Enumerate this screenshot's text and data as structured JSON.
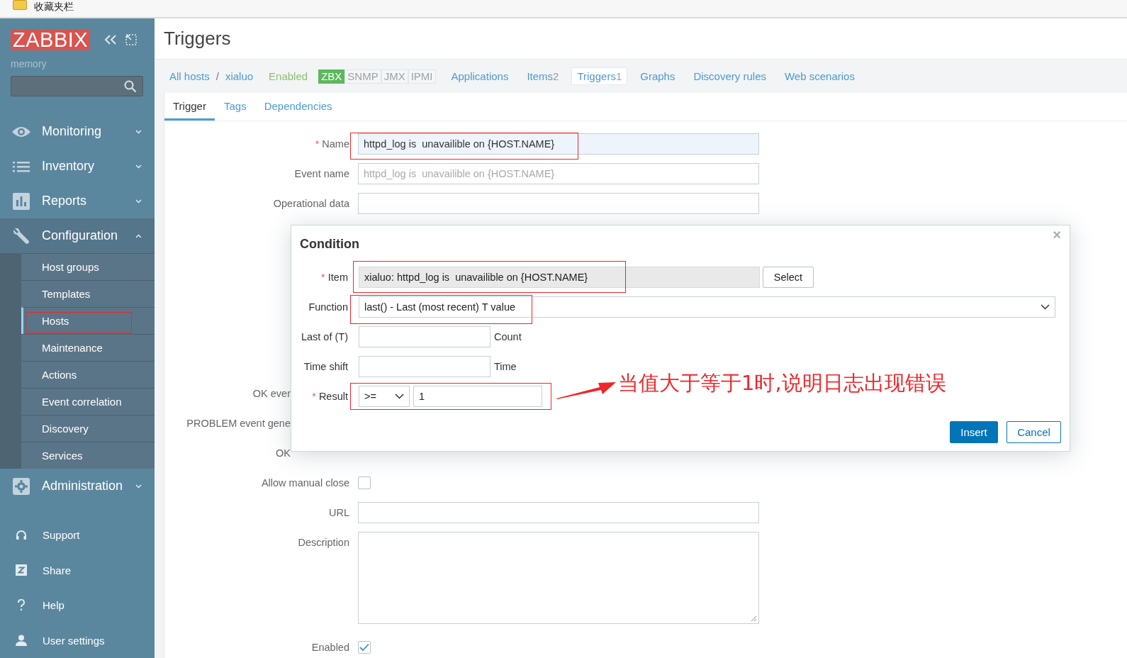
{
  "browser_bar": {
    "bookmarks_label": "收藏夹栏"
  },
  "sidebar": {
    "logo": "ZABBIX",
    "server_name": "memory",
    "menu": [
      {
        "label": "Monitoring",
        "expanded": false
      },
      {
        "label": "Inventory",
        "expanded": false
      },
      {
        "label": "Reports",
        "expanded": false
      },
      {
        "label": "Configuration",
        "expanded": true,
        "children": [
          {
            "label": "Host groups",
            "selected": false
          },
          {
            "label": "Templates",
            "selected": false
          },
          {
            "label": "Hosts",
            "selected": true
          },
          {
            "label": "Maintenance",
            "selected": false
          },
          {
            "label": "Actions",
            "selected": false
          },
          {
            "label": "Event correlation",
            "selected": false
          },
          {
            "label": "Discovery",
            "selected": false
          },
          {
            "label": "Services",
            "selected": false
          }
        ]
      },
      {
        "label": "Administration",
        "expanded": false
      }
    ],
    "footer_links": [
      "Support",
      "Share",
      "Help",
      "User settings"
    ]
  },
  "page": {
    "title": "Triggers",
    "breadcrumb": {
      "items": [
        "All hosts",
        "xialuo"
      ],
      "separator": "/"
    },
    "status": "Enabled",
    "availability": [
      {
        "label": "ZBX",
        "on": true
      },
      {
        "label": "SNMP",
        "on": false
      },
      {
        "label": "JMX",
        "on": false
      },
      {
        "label": "IPMI",
        "on": false
      }
    ],
    "host_tabs": [
      {
        "label": "Applications",
        "selected": false
      },
      {
        "label": "Items",
        "count": "2",
        "selected": false
      },
      {
        "label": "Triggers",
        "count": "1",
        "selected": true
      },
      {
        "label": "Graphs",
        "selected": false
      },
      {
        "label": "Discovery rules",
        "selected": false
      },
      {
        "label": "Web scenarios",
        "selected": false
      }
    ],
    "form_tabs": [
      {
        "label": "Trigger",
        "selected": true
      },
      {
        "label": "Tags",
        "selected": false
      },
      {
        "label": "Dependencies",
        "selected": false
      }
    ],
    "form": [
      {
        "kind": "text",
        "label": "Name",
        "required_mark": "*",
        "focused": true,
        "value": "httpd_log is  unavailible on {HOST.NAME}"
      },
      {
        "kind": "text",
        "label": "Event name",
        "focused": false,
        "placeholder": "httpd_log is  unavailible on {HOST.NAME}"
      },
      {
        "kind": "text",
        "label": "Operational data",
        "focused": false
      },
      {
        "kind": "gap"
      },
      {
        "kind": "covered",
        "label": "OK ever"
      },
      {
        "kind": "covered",
        "label": "PROBLEM event gene"
      },
      {
        "kind": "covered",
        "label": "OK"
      },
      {
        "kind": "checkbox",
        "label": "Allow manual close",
        "checked": false
      },
      {
        "kind": "text",
        "label": "URL",
        "focused": false
      },
      {
        "kind": "textarea",
        "label": "Description"
      },
      {
        "kind": "checkbox",
        "label": "Enabled",
        "checked": true
      }
    ]
  },
  "dialog": {
    "title": "Condition",
    "close": "×",
    "fields": [
      {
        "kind": "item",
        "label": "Item",
        "required_mark": "*",
        "value": "xialuo: httpd_log is  unavailible on {HOST.NAME}",
        "button": "Select"
      },
      {
        "kind": "select",
        "label": "Function",
        "value": "last() - Last (most recent) T value"
      },
      {
        "kind": "unit",
        "label": "Last of (T)",
        "unit": "Count"
      },
      {
        "kind": "unit",
        "label": "Time shift",
        "unit": "Time"
      },
      {
        "kind": "result",
        "label": "Result",
        "required_mark": "*",
        "operator": ">=",
        "value": "1"
      }
    ],
    "buttons": [
      {
        "label": "Insert",
        "primary": true
      },
      {
        "label": "Cancel",
        "primary": false
      }
    ]
  },
  "annotation": {
    "text": "当值大于等于1时,说明日志出现错误"
  }
}
